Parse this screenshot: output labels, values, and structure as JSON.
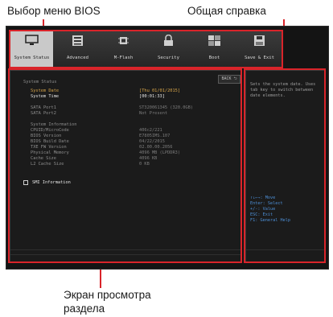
{
  "callouts": {
    "menu_selection": "Выбор меню BIOS",
    "general_help": "Общая справка",
    "section_view": "Экран просмотра\nраздела"
  },
  "menu": {
    "items": [
      {
        "label": "System Status",
        "icon": "monitor-icon",
        "active": true
      },
      {
        "label": "Advanced",
        "icon": "settings-panel-icon",
        "active": false
      },
      {
        "label": "M-Flash",
        "icon": "chip-icon",
        "active": false
      },
      {
        "label": "Security",
        "icon": "lock-icon",
        "active": false
      },
      {
        "label": "Boot",
        "icon": "boot-drives-icon",
        "active": false
      },
      {
        "label": "Save & Exit",
        "icon": "floppy-disk-icon",
        "active": false
      }
    ]
  },
  "section": {
    "title": "System Status",
    "back_label": "BACK ⮌",
    "date_label": "System Date",
    "date_value": "[Thu 01/01/2015]",
    "time_label": "System Time",
    "time_value": "[00:01:33]",
    "sata1_label": "SATA Port1",
    "sata1_value": "ST320061345    (320.0GB)",
    "sata2_label": "SATA Port2",
    "sata2_value": "Not Present",
    "sysinfo_title": "System Information",
    "info_rows": [
      {
        "label": "CPUID/MicroCode",
        "value": "406c2/221"
      },
      {
        "label": "BIOS Version",
        "value": "E7805IMS.107"
      },
      {
        "label": "BIOS Build Date",
        "value": "04/22/2015"
      },
      {
        "label": "TXE FW Version",
        "value": "02.00.00.2056"
      },
      {
        "label": "Physical Memory",
        "value": "4096 MB (LPDDR3)"
      },
      {
        "label": "Cache Size",
        "value": "4096 KB"
      },
      {
        "label": "L2 Cache Size",
        "value": "0 KB"
      }
    ],
    "smi_label": "SMI Information"
  },
  "help": {
    "text": "Sets the system date.  Uses tab key to switch between date elements.",
    "keys": [
      "↑↓←→: Move",
      "Enter: Select",
      "+/-: Value",
      "ESC: Exit",
      "F1: General Help"
    ]
  },
  "colors": {
    "accent_red": "#d9242a",
    "highlight_gold": "#d7a54a",
    "help_blue": "#4d8fd6"
  }
}
